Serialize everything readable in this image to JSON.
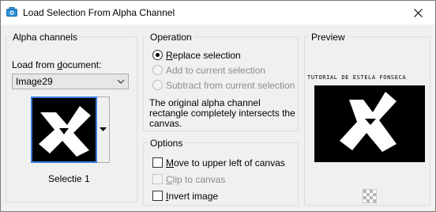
{
  "window": {
    "title": "Load Selection From Alpha Channel",
    "icon": "camera-icon",
    "close": "close-icon"
  },
  "alpha_channels": {
    "group_label": "Alpha channels",
    "load_from_label": "Load from document:",
    "document_value": "Image29",
    "channel_name": "Selectie 1"
  },
  "operation": {
    "group_label": "Operation",
    "options": [
      {
        "label": "Replace selection",
        "selected": true,
        "enabled": true
      },
      {
        "label": "Add to current selection",
        "selected": false,
        "enabled": false
      },
      {
        "label": "Subtract from current selection",
        "selected": false,
        "enabled": false
      }
    ],
    "message": [
      "The original alpha channel",
      "rectangle completely intersects the",
      "canvas."
    ]
  },
  "options": {
    "group_label": "Options",
    "items": [
      {
        "label": "Move to upper left of canvas",
        "checked": false,
        "enabled": true
      },
      {
        "label": "Clip to canvas",
        "checked": false,
        "enabled": false
      },
      {
        "label": "Invert image",
        "checked": false,
        "enabled": true
      }
    ]
  },
  "preview": {
    "group_label": "Preview",
    "caption": "TUTORIAL DE ESTELA FONSECA",
    "transparency_icon": "checkerboard-icon"
  }
}
